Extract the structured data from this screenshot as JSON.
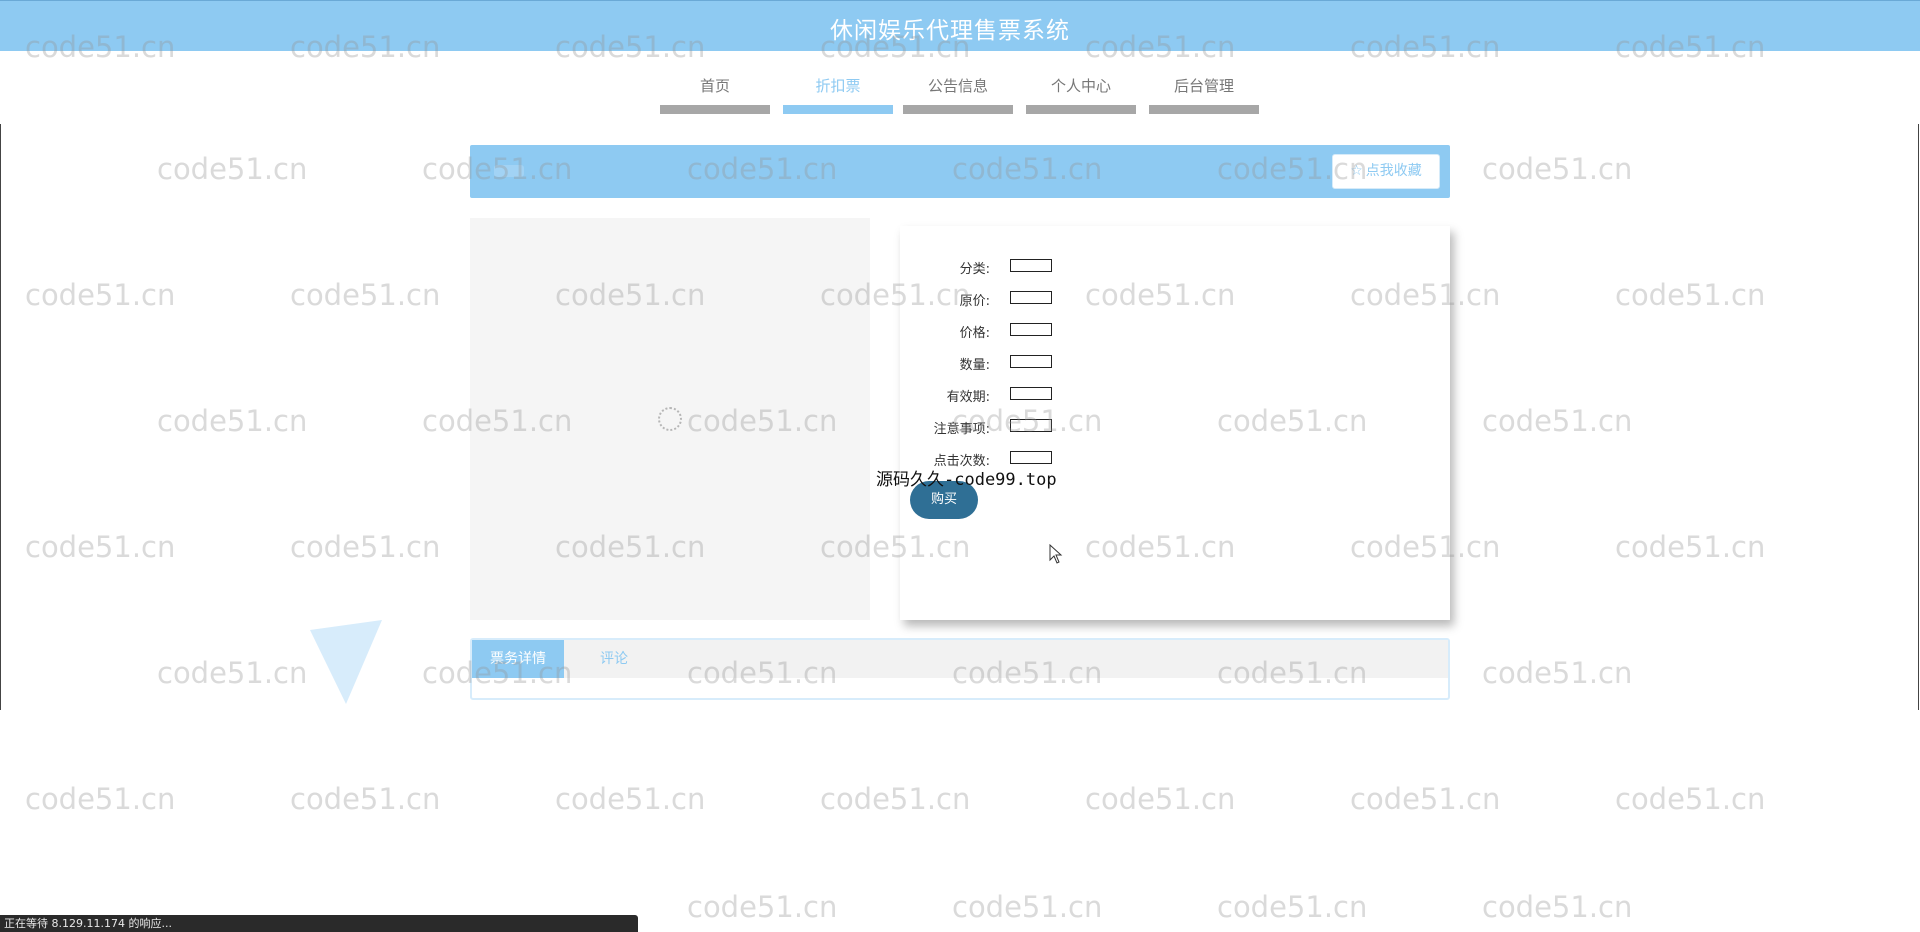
{
  "header": {
    "title": "休闲娱乐代理售票系统"
  },
  "nav": {
    "items": [
      {
        "label": "首页"
      },
      {
        "label": "折扣票"
      },
      {
        "label": "公告信息"
      },
      {
        "label": "个人中心"
      },
      {
        "label": "后台管理"
      }
    ],
    "active_index": 1
  },
  "title_strip": {
    "favorite_label": "点我收藏",
    "favorite_icon": "star-icon"
  },
  "product": {
    "fields": [
      {
        "label": "分类:",
        "value": ""
      },
      {
        "label": "原价:",
        "value": ""
      },
      {
        "label": "价格:",
        "value": ""
      },
      {
        "label": "数量:",
        "value": ""
      },
      {
        "label": "有效期:",
        "value": ""
      },
      {
        "label": "注意事项:",
        "value": ""
      },
      {
        "label": "点击次数:",
        "value": ""
      }
    ],
    "buy_label": "购买"
  },
  "overlay": {
    "text": "源码久久-code99.top"
  },
  "tabs": [
    {
      "label": "票务详情"
    },
    {
      "label": "评论"
    }
  ],
  "status_bar": {
    "text": "正在等待 8.129.11.174 的响应..."
  },
  "watermark": {
    "text": "code51.cn"
  },
  "colors": {
    "accent": "#8ecaf2",
    "button": "#2f6f95",
    "nav_inactive_bar": "#a7a7a7"
  }
}
